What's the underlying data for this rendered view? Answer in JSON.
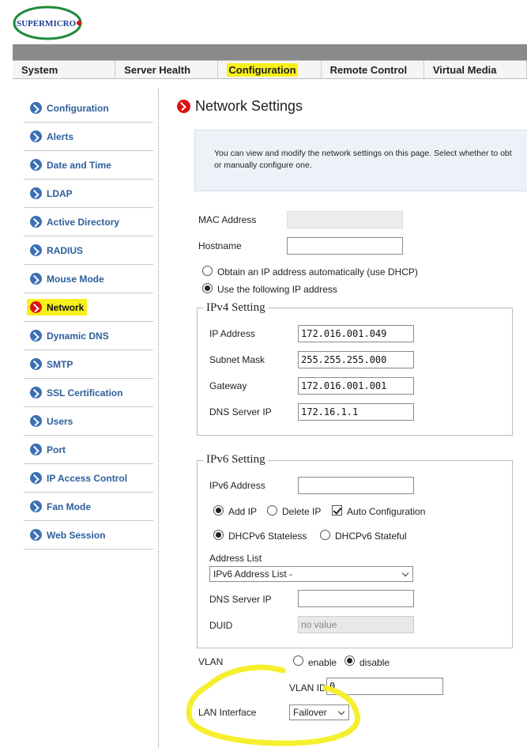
{
  "brand": "SUPERMICRO",
  "colors": {
    "link": "#2e5f9b",
    "highlight": "#f7f01a",
    "accent_red": "#dd1111"
  },
  "topnav": [
    {
      "label": "System"
    },
    {
      "label": "Server Health"
    },
    {
      "label": "Configuration"
    },
    {
      "label": "Remote Control"
    },
    {
      "label": "Virtual Media"
    }
  ],
  "sidebar": [
    {
      "label": "Configuration"
    },
    {
      "label": "Alerts"
    },
    {
      "label": "Date and Time"
    },
    {
      "label": "LDAP"
    },
    {
      "label": "Active Directory"
    },
    {
      "label": "RADIUS"
    },
    {
      "label": "Mouse Mode"
    },
    {
      "label": "Network"
    },
    {
      "label": "Dynamic DNS"
    },
    {
      "label": "SMTP"
    },
    {
      "label": "SSL Certification"
    },
    {
      "label": "Users"
    },
    {
      "label": "Port"
    },
    {
      "label": "IP Access Control"
    },
    {
      "label": "Fan Mode"
    },
    {
      "label": "Web Session"
    }
  ],
  "page": {
    "title": "Network Settings",
    "info_line1": "You can view and modify the network settings on this page. Select whether to obt",
    "info_line2": "or manually configure one."
  },
  "general": {
    "mac_label": "MAC Address",
    "mac_value": "",
    "hostname_label": "Hostname",
    "hostname_value": "",
    "dhcp_label": "Obtain an IP address automatically (use DHCP)",
    "static_label": "Use the following IP address"
  },
  "ipv4": {
    "legend": "IPv4 Setting",
    "ip_label": "IP Address",
    "ip_value": "172.016.001.049",
    "mask_label": "Subnet Mask",
    "mask_value": "255.255.255.000",
    "gateway_label": "Gateway",
    "gateway_value": "172.016.001.001",
    "dns_label": "DNS Server IP",
    "dns_value": "172.16.1.1"
  },
  "ipv6": {
    "legend": "IPv6 Setting",
    "addr_label": "IPv6 Address",
    "addr_value": "",
    "add_ip_label": "Add IP",
    "delete_ip_label": "Delete IP",
    "auto_config_label": "Auto Configuration",
    "stateless_label": "DHCPv6 Stateless",
    "stateful_label": "DHCPv6 Stateful",
    "address_list_label": "Address List",
    "address_list_value": "IPv6 Address List -",
    "dns_label": "DNS Server IP",
    "dns_value": "",
    "duid_label": "DUID",
    "duid_placeholder": "no value"
  },
  "vlan": {
    "label": "VLAN",
    "enable_label": "enable",
    "disable_label": "disable",
    "id_label": "VLAN ID",
    "id_value": "0"
  },
  "lan": {
    "label": "LAN Interface",
    "value": "Failover"
  }
}
